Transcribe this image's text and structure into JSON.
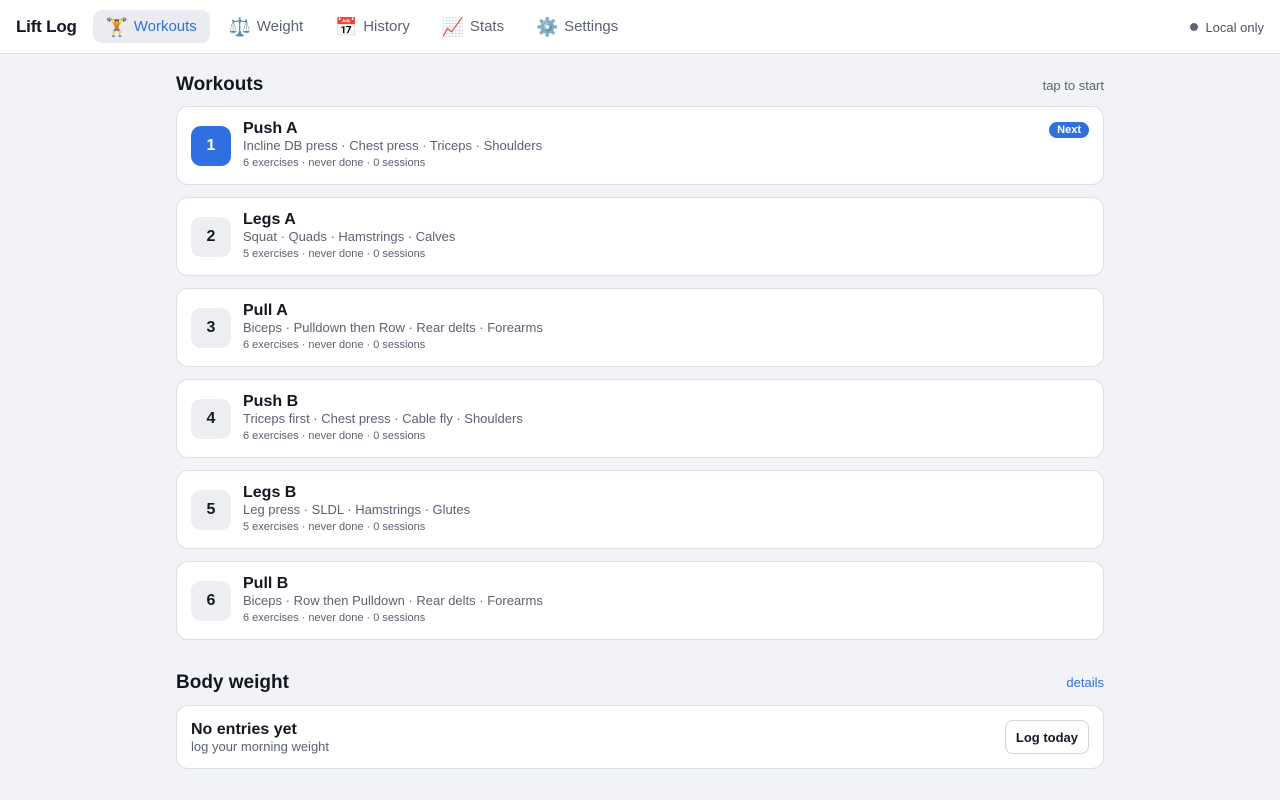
{
  "app": {
    "title": "Lift Log"
  },
  "nav": {
    "tabs": [
      {
        "label": "Workouts",
        "icon": "🏋️",
        "active": true
      },
      {
        "label": "Weight",
        "icon": "⚖️",
        "active": false
      },
      {
        "label": "History",
        "icon": "📅",
        "active": false
      },
      {
        "label": "Stats",
        "icon": "📈",
        "active": false
      },
      {
        "label": "Settings",
        "icon": "⚙️",
        "active": false
      }
    ]
  },
  "status": {
    "label": "Local only"
  },
  "workouts": {
    "title": "Workouts",
    "hint": "tap to start",
    "next_badge": "Next",
    "items": [
      {
        "num": "1",
        "name": "Push A",
        "desc": "Incline DB press · Chest press · Triceps · Shoulders",
        "meta": "6 exercises · never done · 0 sessions"
      },
      {
        "num": "2",
        "name": "Legs A",
        "desc": "Squat · Quads · Hamstrings · Calves",
        "meta": "5 exercises · never done · 0 sessions"
      },
      {
        "num": "3",
        "name": "Pull A",
        "desc": "Biceps · Pulldown then Row · Rear delts · Forearms",
        "meta": "6 exercises · never done · 0 sessions"
      },
      {
        "num": "4",
        "name": "Push B",
        "desc": "Triceps first · Chest press · Cable fly · Shoulders",
        "meta": "6 exercises · never done · 0 sessions"
      },
      {
        "num": "5",
        "name": "Legs B",
        "desc": "Leg press · SLDL · Hamstrings · Glutes",
        "meta": "5 exercises · never done · 0 sessions"
      },
      {
        "num": "6",
        "name": "Pull B",
        "desc": "Biceps · Row then Pulldown · Rear delts · Forearms",
        "meta": "6 exercises · never done · 0 sessions"
      }
    ]
  },
  "body_weight": {
    "title": "Body weight",
    "link": "details",
    "empty_title": "No entries yet",
    "empty_sub": "log your morning weight",
    "log_button": "Log today"
  },
  "colors": {
    "accent": "#2f6fe0",
    "background": "#f2f3f6",
    "card": "#ffffff"
  }
}
